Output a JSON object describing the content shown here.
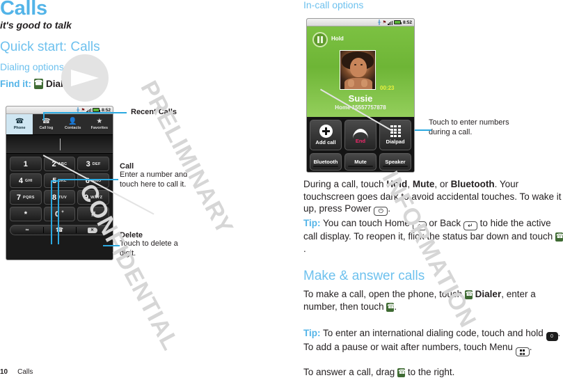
{
  "document": {
    "chapter_title": "Calls",
    "subtitle": "it's good to talk",
    "quick_start_heading": "Quick start: Calls",
    "dialing_options_heading": "Dialing options",
    "find_it_label": "Find it:",
    "find_it_target": "Dialer",
    "in_call_options_heading": "In-call options",
    "make_answer_heading": "Make & answer calls"
  },
  "watermark": {
    "line1": "CONFIDENTIAL",
    "line2": "INFORMATION",
    "line3": "PRELIMINARY"
  },
  "dialer_device": {
    "status_bar": {
      "time": "8:52",
      "bluetooth_icon": "bluetooth-icon",
      "alert_icon": "alert-icon",
      "signal_icon": "signal-bars-icon",
      "battery_icon": "battery-icon"
    },
    "tabs": [
      {
        "label": "Phone",
        "icon": "phone-handset-icon",
        "active": true
      },
      {
        "label": "Call log",
        "icon": "call-log-icon",
        "active": false
      },
      {
        "label": "Contacts",
        "icon": "contact-person-icon",
        "active": false
      },
      {
        "label": "Favorites",
        "icon": "star-icon",
        "active": false
      }
    ],
    "keys": [
      {
        "digit": "1",
        "letters": ""
      },
      {
        "digit": "2",
        "letters": "ABC"
      },
      {
        "digit": "3",
        "letters": "DEF"
      },
      {
        "digit": "4",
        "letters": "GHI"
      },
      {
        "digit": "5",
        "letters": "JKL"
      },
      {
        "digit": "6",
        "letters": "MNO"
      },
      {
        "digit": "7",
        "letters": "PQRS"
      },
      {
        "digit": "8",
        "letters": "TUV"
      },
      {
        "digit": "9",
        "letters": "WXYZ"
      },
      {
        "digit": "*",
        "letters": ""
      },
      {
        "digit": "0",
        "letters": "+"
      },
      {
        "digit": "#",
        "letters": ""
      }
    ],
    "action_row": {
      "voicemail_label": "∞",
      "call_icon": "phone-handset-icon",
      "delete_icon": "backspace-icon",
      "delete_glyph": "✕"
    }
  },
  "callouts": {
    "recent_calls": {
      "title": "Recent Calls",
      "body": ""
    },
    "call": {
      "title": "Call",
      "body": "Enter a number and touch here to call it."
    },
    "delete": {
      "title": "Delete",
      "body": "Touch to delete a digit."
    },
    "dialpad": {
      "body": "Touch to enter numbers during a call."
    }
  },
  "call_device": {
    "status_bar": {
      "time": "8:52"
    },
    "hold_label": "Hold",
    "timer": "00:23",
    "contact_name": "Susie",
    "contact_number": "Home 15557757878",
    "primary_buttons": [
      {
        "label": "Add call",
        "icon": "add-call-plus-icon"
      },
      {
        "label": "End",
        "icon": "end-call-handset-icon"
      },
      {
        "label": "Dialpad",
        "icon": "dialpad-grid-icon"
      }
    ],
    "secondary_buttons": [
      {
        "label": "Bluetooth"
      },
      {
        "label": "Mute"
      },
      {
        "label": "Speaker"
      }
    ]
  },
  "paragraphs": {
    "p1": {
      "parts": [
        {
          "t": "During a call, touch ",
          "b": false
        },
        {
          "t": "Hold",
          "b": true
        },
        {
          "t": ", ",
          "b": false
        },
        {
          "t": "Mute",
          "b": true
        },
        {
          "t": ", or ",
          "b": false
        },
        {
          "t": "Bluetooth",
          "b": true
        },
        {
          "t": ". Your touchscreen goes dark to avoid accidental touches. To wake it up, press Power ",
          "b": false
        }
      ],
      "end": "."
    },
    "p2": {
      "tip": "Tip:",
      "a": " You can touch Home ",
      "b": " or Back ",
      "c": " to hide the active call display. To reopen it, flick the status bar down and touch ",
      "d": "."
    },
    "p3": {
      "a": "To make a call, open the phone, touch ",
      "b": "Dialer",
      "c": ", enter a number, then touch ",
      "d": "."
    },
    "p4": {
      "tip": "Tip:",
      "a": " To enter an international dialing code, touch and hold ",
      "b": ". To add a pause or wait after numbers, touch Menu ",
      "c": "."
    },
    "p5": {
      "a": "To answer a call, drag ",
      "b": " to the right."
    }
  },
  "footer": {
    "page_number": "10",
    "chapter": "Calls"
  },
  "colors": {
    "accent_blue": "#53b4e8",
    "heading_blue": "#6ec1ee",
    "lead_line": "#2ba9e0",
    "call_green": "#7cc142",
    "end_red": "#f0286a",
    "dialer_icon_green": "#3f6b33"
  }
}
